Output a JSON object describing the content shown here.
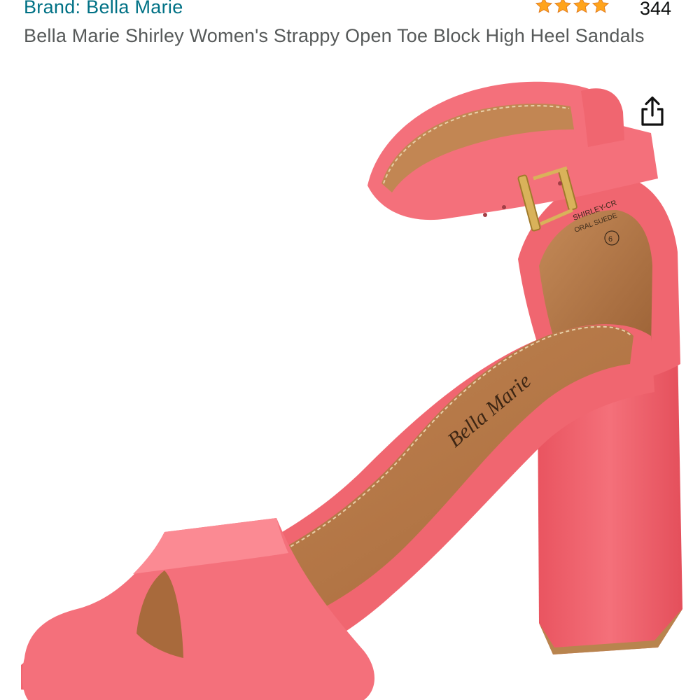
{
  "product": {
    "brand_link": "Brand: Bella Marie",
    "rating": {
      "stars": 4,
      "max_stars": 5,
      "count": "344"
    },
    "title": "Bella Marie Shirley Women's Strappy Open Toe Block High Heel Sandals"
  },
  "image": {
    "insole_logo": "Bella Marie",
    "label_text": "SHIRLEY-CR",
    "label_material": "ORAL SUEDE",
    "label_size": "6",
    "colors": {
      "suede": "#f0606a",
      "insole": "#b97a4a",
      "buckle": "#d9b25a"
    }
  },
  "icons": {
    "share": "share-icon",
    "star": "star-icon"
  },
  "colors": {
    "link": "#007185",
    "star_fill": "#ffa41c",
    "title_text": "#565959"
  }
}
